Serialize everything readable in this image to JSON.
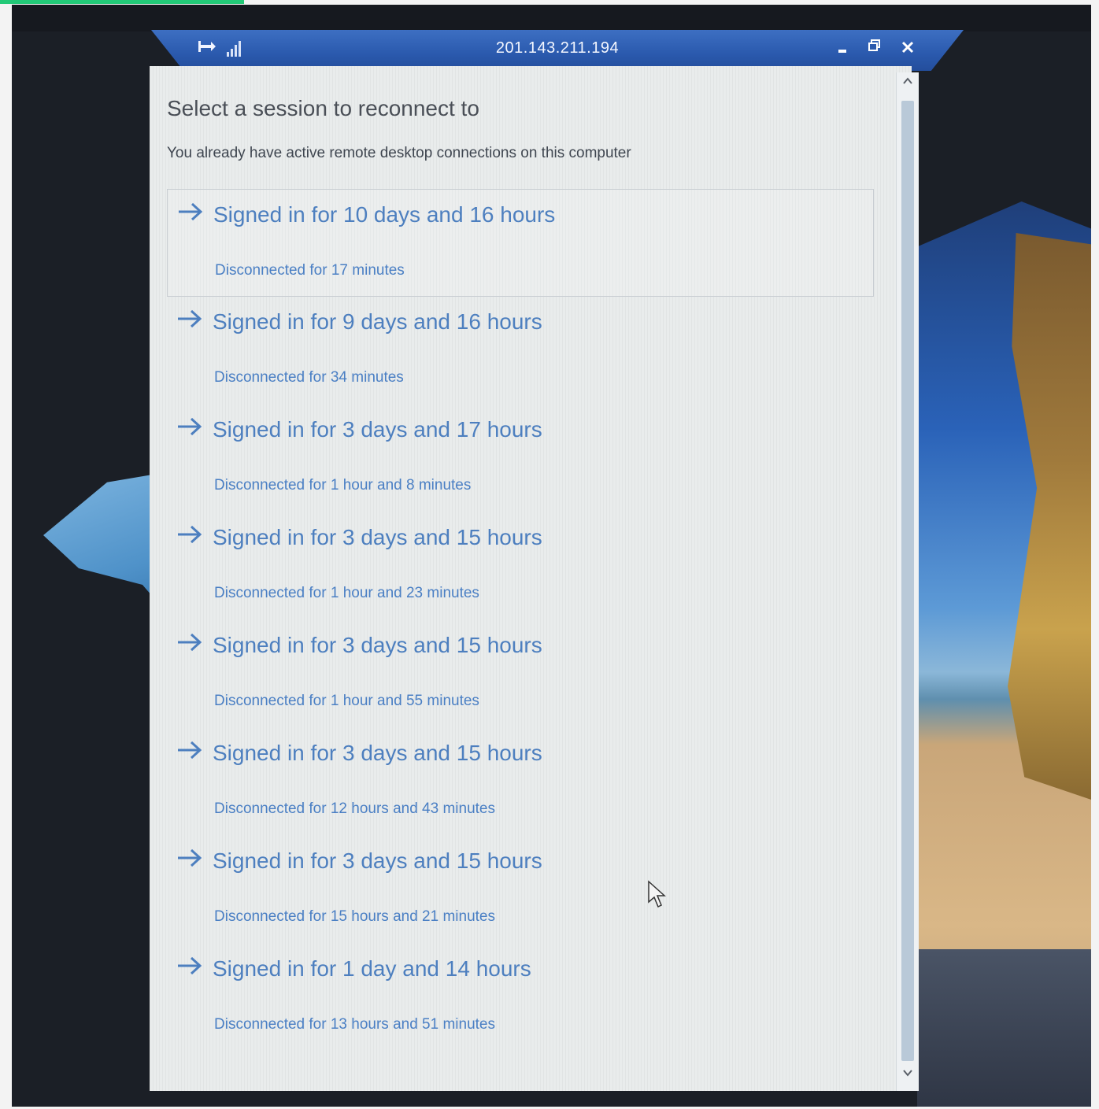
{
  "window": {
    "host": "201.143.211.194"
  },
  "dialog": {
    "title": "Select a session to reconnect to",
    "subtitle": "You already have active remote desktop connections on this computer"
  },
  "sessions": [
    {
      "signed_in": "Signed in for 10 days and 16 hours",
      "disconnected": "Disconnected for 17 minutes"
    },
    {
      "signed_in": "Signed in for 9 days and 16 hours",
      "disconnected": "Disconnected for 34 minutes"
    },
    {
      "signed_in": "Signed in for 3 days and 17 hours",
      "disconnected": "Disconnected for 1 hour and 8 minutes"
    },
    {
      "signed_in": "Signed in for 3 days and 15 hours",
      "disconnected": "Disconnected for 1 hour and 23 minutes"
    },
    {
      "signed_in": "Signed in for 3 days and 15 hours",
      "disconnected": "Disconnected for 1 hour and 55 minutes"
    },
    {
      "signed_in": "Signed in for 3 days and 15 hours",
      "disconnected": "Disconnected for 12 hours and 43 minutes"
    },
    {
      "signed_in": "Signed in for 3 days and 15 hours",
      "disconnected": "Disconnected for 15 hours and 21 minutes"
    },
    {
      "signed_in": "Signed in for 1 day and 14 hours",
      "disconnected": "Disconnected for 13 hours and 51 minutes"
    }
  ],
  "icons": {
    "pin": "pin-icon",
    "signal": "signal-strength-icon",
    "minimize": "minimize-icon",
    "restore": "restore-icon",
    "close": "close-icon",
    "arrow": "arrow-right-icon",
    "cursor": "mouse-pointer-icon"
  },
  "colors": {
    "titlebar": "#2a59ad",
    "session_link": "#4d7fbf",
    "dialog_bg": "#e9ecec"
  }
}
